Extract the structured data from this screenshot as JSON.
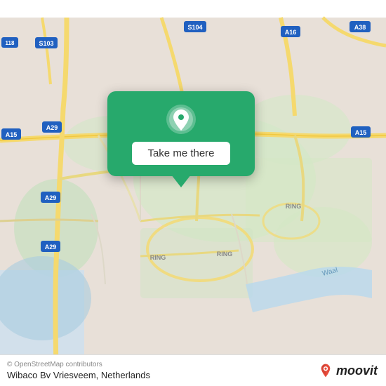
{
  "map": {
    "background_color": "#e8e0d8",
    "water_color": "#a8d4e8",
    "green_color": "#c8dfc8",
    "road_color": "#f5d96e",
    "highway_color": "#f5d96e"
  },
  "popup": {
    "background_color": "#27a96c",
    "button_label": "Take me there",
    "button_bg": "#ffffff"
  },
  "bottom_bar": {
    "copyright": "© OpenStreetMap contributors",
    "location_name": "Wibaco Bv Vriesveem, Netherlands",
    "brand_name": "moovit"
  },
  "road_labels": [
    "A38",
    "A16",
    "S104",
    "S103",
    "118",
    "A15",
    "A29",
    "A15",
    "RING",
    "RING",
    "A29",
    "A29",
    "Waal"
  ],
  "icons": {
    "pin": "location-pin",
    "moovit_logo": "moovit-brand"
  }
}
